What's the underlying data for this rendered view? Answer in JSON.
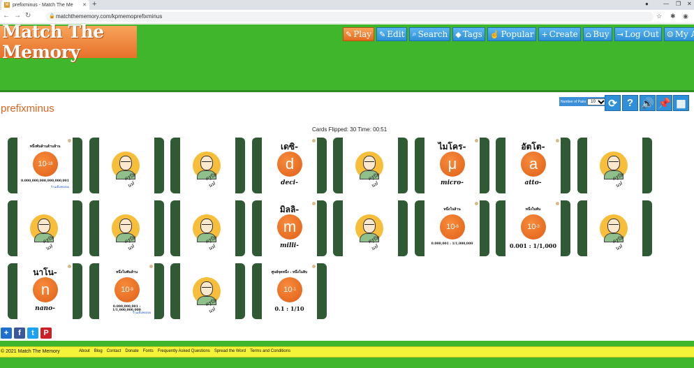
{
  "browser": {
    "tab_title": "prefixminus - Match The Me",
    "tab_favicon": "M",
    "url": "matchthememory.com/kpmemoprefixminus"
  },
  "site": {
    "logo": "Match The Memory",
    "nav": [
      {
        "label": "Play",
        "icon": "✎"
      },
      {
        "label": "Edit",
        "icon": "✎"
      },
      {
        "label": "Search",
        "icon": "⌕"
      },
      {
        "label": "Tags",
        "icon": "◆"
      },
      {
        "label": "Popular",
        "icon": "☝"
      },
      {
        "label": "Create",
        "icon": "+"
      },
      {
        "label": "Buy",
        "icon": "⌂"
      },
      {
        "label": "Log Out",
        "icon": "⇥"
      },
      {
        "label": "My Account",
        "icon": "☺"
      }
    ]
  },
  "game": {
    "title": "prefixminus",
    "pairs_label": "Number of Pairs",
    "pairs_value": "10",
    "status": "Cards Flipped: 30  Time: 00:51"
  },
  "cards": [
    {
      "type": "power",
      "top": "หนึ่งพันล้านล้านล้าน",
      "exp": "-18",
      "bottom": "0.000,000,000,000,000,001",
      "note": "ร้านเต็มทดสอบ"
    },
    {
      "type": "portrait"
    },
    {
      "type": "portrait"
    },
    {
      "type": "letter",
      "top": "เดซิ-",
      "letter": "d",
      "bottom": "deci-"
    },
    {
      "type": "portrait"
    },
    {
      "type": "letter",
      "top": "ไมโคร-",
      "letter": "μ",
      "bottom": "micro-"
    },
    {
      "type": "letter",
      "top": "อัตโต-",
      "letter": "a",
      "bottom": "atto-"
    },
    {
      "type": "portrait"
    },
    {
      "type": "portrait"
    },
    {
      "type": "portrait"
    },
    {
      "type": "portrait"
    },
    {
      "type": "letter",
      "top": "มิลลิ-",
      "letter": "m",
      "bottom": "milli-"
    },
    {
      "type": "portrait"
    },
    {
      "type": "power",
      "top": "หนึ่งในล้าน",
      "exp": "-6",
      "bottom": "0.000,001 : 1/1,000,000"
    },
    {
      "type": "power",
      "top": "หนึ่งในพัน",
      "exp": "-3",
      "bottom": "0.001 : 1/1,000"
    },
    {
      "type": "portrait"
    },
    {
      "type": "letter",
      "top": "นาโน-",
      "letter": "n",
      "bottom": "nano-"
    },
    {
      "type": "power",
      "top": "หนึ่งในพันล้าน",
      "exp": "-9",
      "bottom": "0.000,000,001 : 1/1,000,000,000",
      "note": "ร้านเต็มทดสอบ"
    },
    {
      "type": "portrait"
    },
    {
      "type": "power",
      "top": "ศูนย์จุดหนึ่ง : หนึ่งในสิบ",
      "exp": "-1",
      "bottom": "0.1 : 1/10"
    }
  ],
  "portrait_signature": "ครูปิยนท์",
  "share": [
    {
      "label": "+",
      "color": "#1e6fd0"
    },
    {
      "label": "f",
      "color": "#3b5998"
    },
    {
      "label": "t",
      "color": "#1da1f2"
    },
    {
      "label": "P",
      "color": "#cb2027"
    }
  ],
  "footer": {
    "copyright": "© 2021 Match The Memory",
    "links": [
      "About",
      "Blog",
      "Contact",
      "Donate",
      "Fonts",
      "Frequently Asked Questions",
      "Spread the Word",
      "Terms and Conditions"
    ]
  }
}
